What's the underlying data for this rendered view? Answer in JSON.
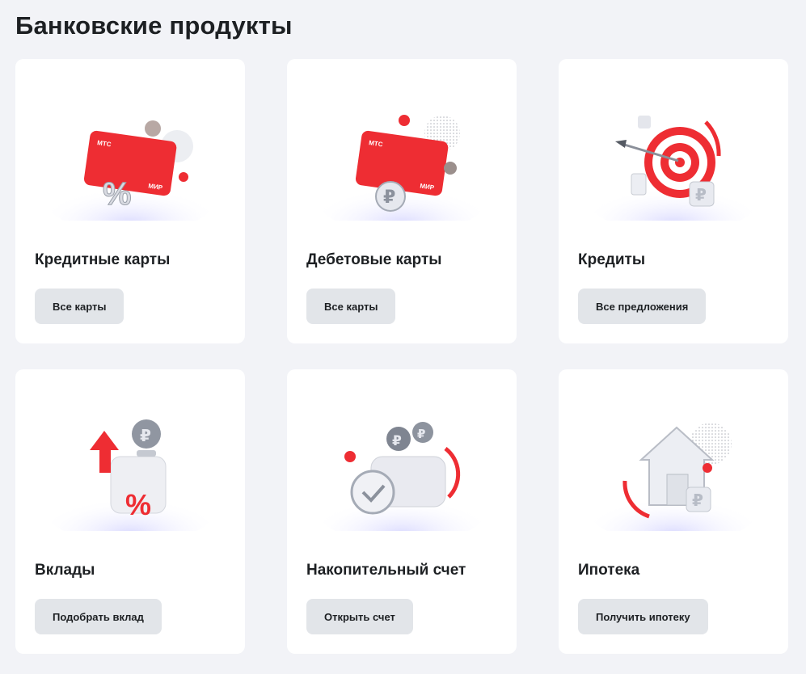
{
  "page": {
    "title": "Банковские продукты"
  },
  "products": [
    {
      "title": "Кредитные карты",
      "button": "Все карты",
      "icon": "credit-card-percent-icon"
    },
    {
      "title": "Дебетовые карты",
      "button": "Все карты",
      "icon": "debit-card-ruble-icon"
    },
    {
      "title": "Кредиты",
      "button": "Все предложения",
      "icon": "target-ruble-icon"
    },
    {
      "title": "Вклады",
      "button": "Подобрать вклад",
      "icon": "deposit-box-percent-icon"
    },
    {
      "title": "Накопительный счет",
      "button": "Открыть счет",
      "icon": "wallet-checkmark-icon"
    },
    {
      "title": "Ипотека",
      "button": "Получить ипотеку",
      "icon": "house-ruble-icon"
    }
  ],
  "illustration_text": {
    "card_brand": "МТС",
    "card_network": "МИР",
    "percent": "%",
    "ruble": "₽"
  },
  "colors": {
    "page_bg": "#f2f3f7",
    "card_bg": "#ffffff",
    "button_bg": "#e2e5e9",
    "accent_red": "#ee2d33"
  }
}
